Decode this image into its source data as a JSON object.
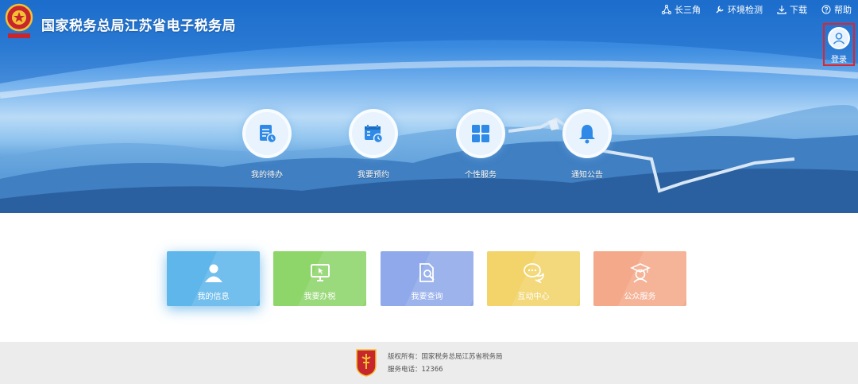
{
  "header": {
    "site_title": "国家税务总局江苏省电子税务局",
    "top_links": [
      {
        "label": "长三角",
        "icon": "network-icon"
      },
      {
        "label": "环境检测",
        "icon": "tool-icon"
      },
      {
        "label": "下载",
        "icon": "download-icon"
      },
      {
        "label": "帮助",
        "icon": "help-icon"
      }
    ],
    "login": {
      "label": "登录",
      "icon": "user-icon"
    }
  },
  "quick_access": [
    {
      "label": "我的待办",
      "icon": "todo-document-icon"
    },
    {
      "label": "我要预约",
      "icon": "calendar-clock-icon"
    },
    {
      "label": "个性服务",
      "icon": "grid-icon"
    },
    {
      "label": "通知公告",
      "icon": "bell-icon"
    }
  ],
  "tiles": [
    {
      "label": "我的信息",
      "icon": "user-profile-icon",
      "color": "#5fb6ea",
      "active": true
    },
    {
      "label": "我要办税",
      "icon": "monitor-cursor-icon",
      "color": "#8ed56a",
      "active": false
    },
    {
      "label": "我要查询",
      "icon": "document-search-icon",
      "color": "#8fa9ea",
      "active": false
    },
    {
      "label": "互动中心",
      "icon": "chat-bubbles-icon",
      "color": "#f2d46a",
      "active": false
    },
    {
      "label": "公众服务",
      "icon": "graduate-icon",
      "color": "#f4a98a",
      "active": false
    }
  ],
  "footer": {
    "copyright": "版权所有：国家税务总局江苏省税务局",
    "phone": "服务电话：12366"
  },
  "colors": {
    "login_highlight": "#e0242c",
    "accent_blue": "#1b6fd0"
  }
}
